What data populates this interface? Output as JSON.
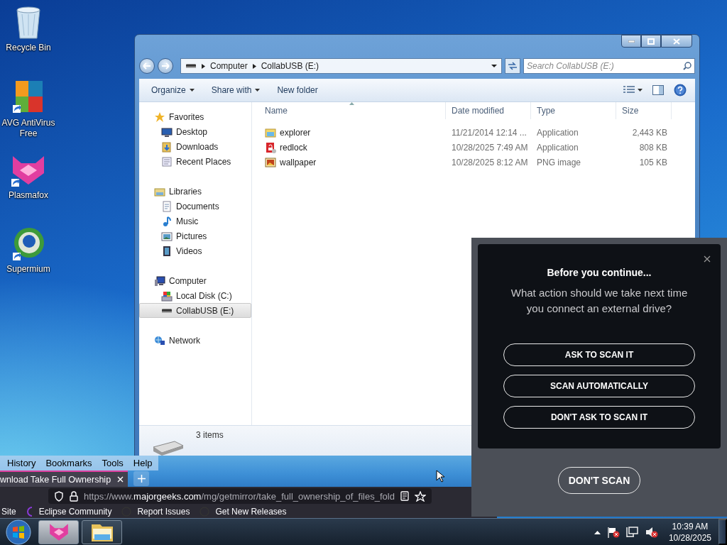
{
  "desktop_icons": [
    {
      "label": "Recycle Bin",
      "kind": "bin",
      "shortcut": false
    },
    {
      "label": "AVG AntiVirus Free",
      "kind": "avg",
      "shortcut": true
    },
    {
      "label": "Plasmafox",
      "kind": "fox",
      "shortcut": true
    },
    {
      "label": "Supermium",
      "kind": "orb",
      "shortcut": true
    }
  ],
  "explorer": {
    "breadcrumb": [
      "Computer",
      "CollabUSB (E:)"
    ],
    "search": {
      "placeholder": "Search CollabUSB (E:)"
    },
    "toolbar": [
      {
        "label": "Organize",
        "menu": true
      },
      {
        "label": "Share with",
        "menu": true
      },
      {
        "label": "New folder",
        "menu": false
      }
    ],
    "nav": [
      {
        "label": "Favorites",
        "kind": "star",
        "selected": false,
        "children": [
          {
            "label": "Desktop",
            "kind": "desktop",
            "selected": false
          },
          {
            "label": "Downloads",
            "kind": "downloads",
            "selected": false
          },
          {
            "label": "Recent Places",
            "kind": "recent",
            "selected": false
          }
        ]
      },
      {
        "label": "Libraries",
        "kind": "library",
        "selected": false,
        "children": [
          {
            "label": "Documents",
            "kind": "documents",
            "selected": false
          },
          {
            "label": "Music",
            "kind": "music",
            "selected": false
          },
          {
            "label": "Pictures",
            "kind": "pictures",
            "selected": false
          },
          {
            "label": "Videos",
            "kind": "videos",
            "selected": false
          }
        ]
      },
      {
        "label": "Computer",
        "kind": "computer",
        "selected": false,
        "children": [
          {
            "label": "Local Disk (C:)",
            "kind": "disk",
            "selected": false
          },
          {
            "label": "CollabUSB (E:)",
            "kind": "usb",
            "selected": true
          }
        ]
      },
      {
        "label": "Network",
        "kind": "network",
        "selected": false
      }
    ],
    "columns": [
      "Name",
      "Date modified",
      "Type",
      "Size"
    ],
    "rows": [
      {
        "kind": "window",
        "name": "explorer",
        "date": "11/21/2014 12:14 ...",
        "type": "Application",
        "size": "2,443 KB"
      },
      {
        "kind": "lock",
        "name": "redlock",
        "date": "10/28/2025 7:49 AM",
        "type": "Application",
        "size": "808 KB"
      },
      {
        "kind": "image",
        "name": "wallpaper",
        "date": "10/28/2025 8:12 AM",
        "type": "PNG image",
        "size": "105 KB"
      }
    ],
    "status": "3 items"
  },
  "browser": {
    "menu": [
      "History",
      "Bookmarks",
      "Tools",
      "Help"
    ],
    "tab_title": "wnload Take Full Ownership",
    "url": {
      "host_prefix": "https://www.",
      "domain": "majorgeeks.com",
      "path": "/mg/getmirror/take_full_ownership_of_files_fold"
    },
    "bookmarks": [
      "Site",
      "Eclipse Community",
      "Report Issues",
      "Get New Releases"
    ]
  },
  "dialog": {
    "title": "Before you continue...",
    "message": "What action should we take next time you connect an external drive?",
    "options": [
      "ASK TO SCAN IT",
      "SCAN AUTOMATICALLY",
      "DON'T ASK TO SCAN IT"
    ],
    "dismiss": "DON'T SCAN"
  },
  "taskbar": {
    "buttons": [
      {
        "kind": "fox",
        "selected": true
      },
      {
        "kind": "folder",
        "selected": false
      }
    ],
    "time": "10:39 AM",
    "date": "10/28/2025"
  }
}
